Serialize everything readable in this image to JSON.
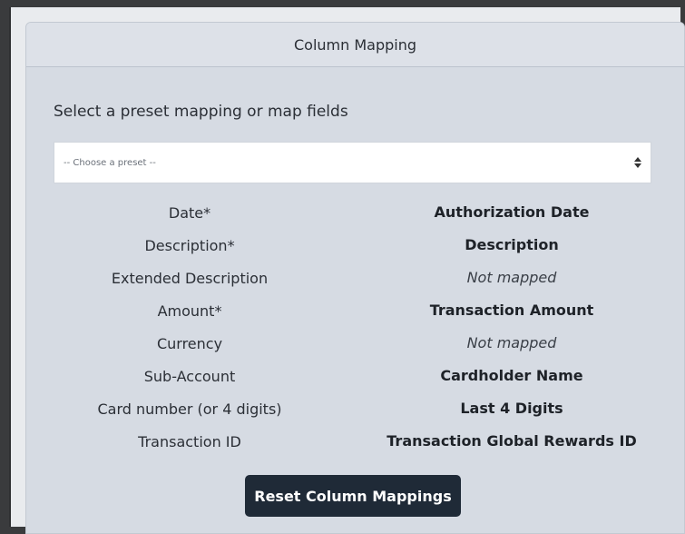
{
  "card": {
    "title": "Column Mapping",
    "intro": "Select a preset mapping or map fields"
  },
  "preset": {
    "placeholder": "-- Choose a preset --"
  },
  "mappings": [
    {
      "field": "Date*",
      "mapped": "Authorization Date",
      "is_mapped": true
    },
    {
      "field": "Description*",
      "mapped": "Description",
      "is_mapped": true
    },
    {
      "field": "Extended Description",
      "mapped": "Not mapped",
      "is_mapped": false
    },
    {
      "field": "Amount*",
      "mapped": "Transaction Amount",
      "is_mapped": true
    },
    {
      "field": "Currency",
      "mapped": "Not mapped",
      "is_mapped": false
    },
    {
      "field": "Sub-Account",
      "mapped": "Cardholder Name",
      "is_mapped": true
    },
    {
      "field": "Card number (or 4 digits)",
      "mapped": "Last 4 Digits",
      "is_mapped": true
    },
    {
      "field": "Transaction ID",
      "mapped": "Transaction Global Rewards ID",
      "is_mapped": true
    }
  ],
  "actions": {
    "reset_label": "Reset Column Mappings"
  },
  "colors": {
    "background": "#3a3b3d",
    "card": "#d6dbe3",
    "button": "#1f2a37"
  },
  "icons": {
    "select": "sort-updown-icon"
  }
}
